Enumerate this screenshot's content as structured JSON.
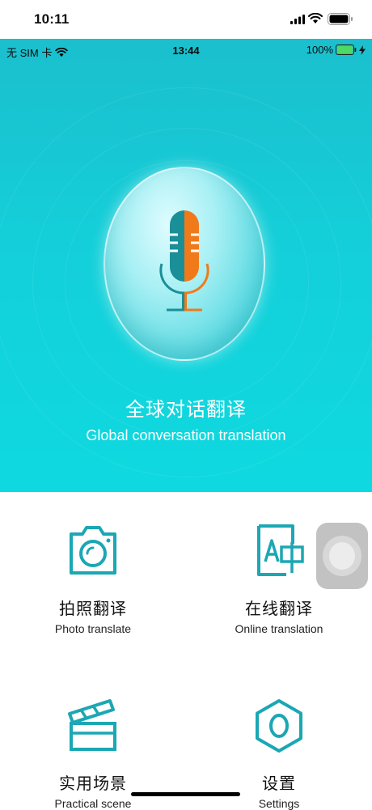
{
  "outer_status": {
    "time": "10:11"
  },
  "inner_status": {
    "carrier": "无 SIM 卡",
    "time": "13:44",
    "battery": "100%"
  },
  "hero": {
    "title": "全球对话翻译",
    "subtitle": "Global conversation translation"
  },
  "features": [
    {
      "cn": "拍照翻译",
      "en": "Photo translate",
      "icon": "camera-icon"
    },
    {
      "cn": "在线翻译",
      "en": "Online translation",
      "icon": "translate-icon"
    },
    {
      "cn": "实用场景",
      "en": "Practical scene",
      "icon": "clapperboard-icon"
    },
    {
      "cn": "设置",
      "en": "Settings",
      "icon": "settings-icon"
    }
  ],
  "colors": {
    "accent": "#1ba7b4",
    "header_top": "#1bbfcd",
    "header_bottom": "#0fd9e0",
    "mic_left": "#1a8f98",
    "mic_right": "#f07a1a"
  }
}
